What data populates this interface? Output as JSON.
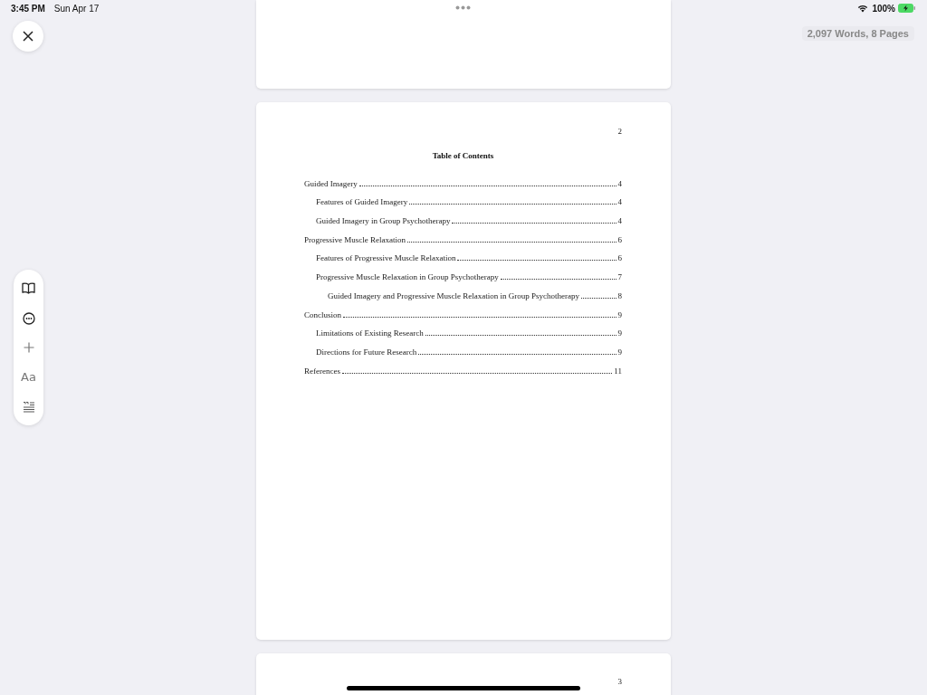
{
  "status_bar": {
    "time": "3:45 PM",
    "date": "Sun Apr 17",
    "battery": "100%"
  },
  "word_count": "2,097 Words, 8 Pages",
  "toolbar": {
    "font_label": "Aa"
  },
  "pages": [
    {
      "kind": "blank"
    },
    {
      "kind": "toc",
      "number": "2",
      "title": "Table of Contents",
      "entries": [
        {
          "label": "Guided Imagery",
          "page": "4",
          "children": [
            {
              "label": "Features of Guided Imagery",
              "page": "4"
            },
            {
              "label": "Guided Imagery in Group Psychotherapy",
              "page": "4"
            }
          ]
        },
        {
          "label": "Progressive Muscle Relaxation",
          "page": "6",
          "children": [
            {
              "label": "Features of Progressive Muscle Relaxation",
              "page": "6"
            },
            {
              "label": "Progressive Muscle Relaxation in Group Psychotherapy",
              "page": "7",
              "children": [
                {
                  "label": "Guided Imagery and Progressive Muscle Relaxation in Group Psychotherapy",
                  "page": "8"
                }
              ]
            }
          ]
        },
        {
          "label": "Conclusion",
          "page": "9",
          "children": [
            {
              "label": "Limitations of Existing Research",
              "page": "9"
            },
            {
              "label": "Directions for Future Research",
              "page": "9"
            }
          ]
        },
        {
          "label": "References",
          "page": "11"
        }
      ]
    },
    {
      "kind": "next",
      "number": "3"
    }
  ]
}
